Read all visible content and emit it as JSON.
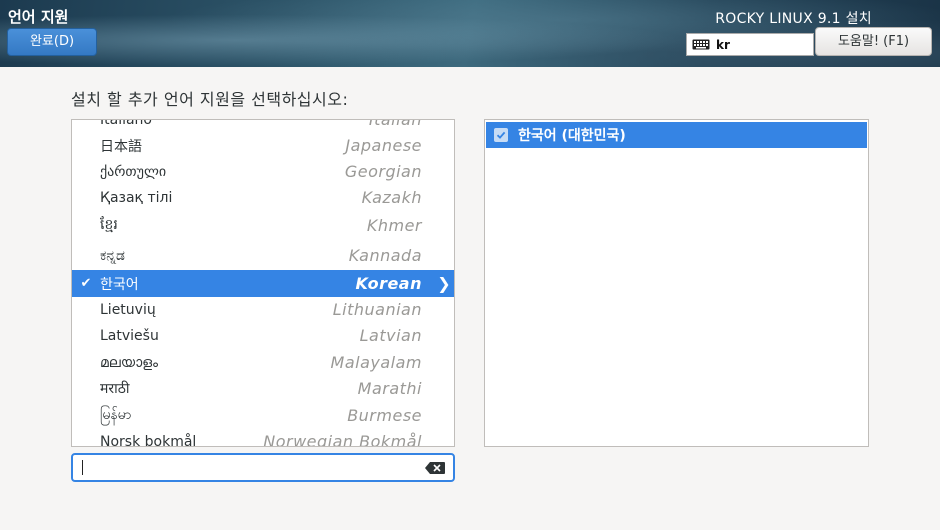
{
  "header": {
    "title": "언어 지원",
    "done_label": "완료(D)",
    "product": "ROCKY LINUX 9.1 설치",
    "keyboard_layout": "kr",
    "help_label": "도움말! (F1)"
  },
  "prompt": "설치 할 추가 언어 지원을 선택하십시오:",
  "languages": [
    {
      "native": "Italiano",
      "english": "Italian",
      "selected": false
    },
    {
      "native": "日本語",
      "english": "Japanese",
      "selected": false
    },
    {
      "native": "ქართული",
      "english": "Georgian",
      "selected": false
    },
    {
      "native": "Қазақ тілі",
      "english": "Kazakh",
      "selected": false
    },
    {
      "native": "ខ្មែរ",
      "english": "Khmer",
      "selected": false
    },
    {
      "native": "ಕನ್ನಡ",
      "english": "Kannada",
      "selected": false
    },
    {
      "native": "한국어",
      "english": "Korean",
      "selected": true
    },
    {
      "native": "Lietuvių",
      "english": "Lithuanian",
      "selected": false
    },
    {
      "native": "Latviešu",
      "english": "Latvian",
      "selected": false
    },
    {
      "native": "മലയാളം",
      "english": "Malayalam",
      "selected": false
    },
    {
      "native": "मराठी",
      "english": "Marathi",
      "selected": false
    },
    {
      "native": "မြန်မာ",
      "english": "Burmese",
      "selected": false
    },
    {
      "native": "Norsk bokmål",
      "english": "Norwegian Bokmål",
      "selected": false
    }
  ],
  "locales": [
    {
      "label": "한국어 (대한민국)",
      "checked": true
    }
  ],
  "search": {
    "value": "",
    "placeholder": ""
  },
  "colors": {
    "accent": "#3584e4",
    "header_dark": "#1c3a4f"
  },
  "icons": {
    "keyboard": "keyboard-icon",
    "check": "check-icon",
    "arrow": "chevron-right-icon",
    "clear": "backspace-clear-icon"
  }
}
